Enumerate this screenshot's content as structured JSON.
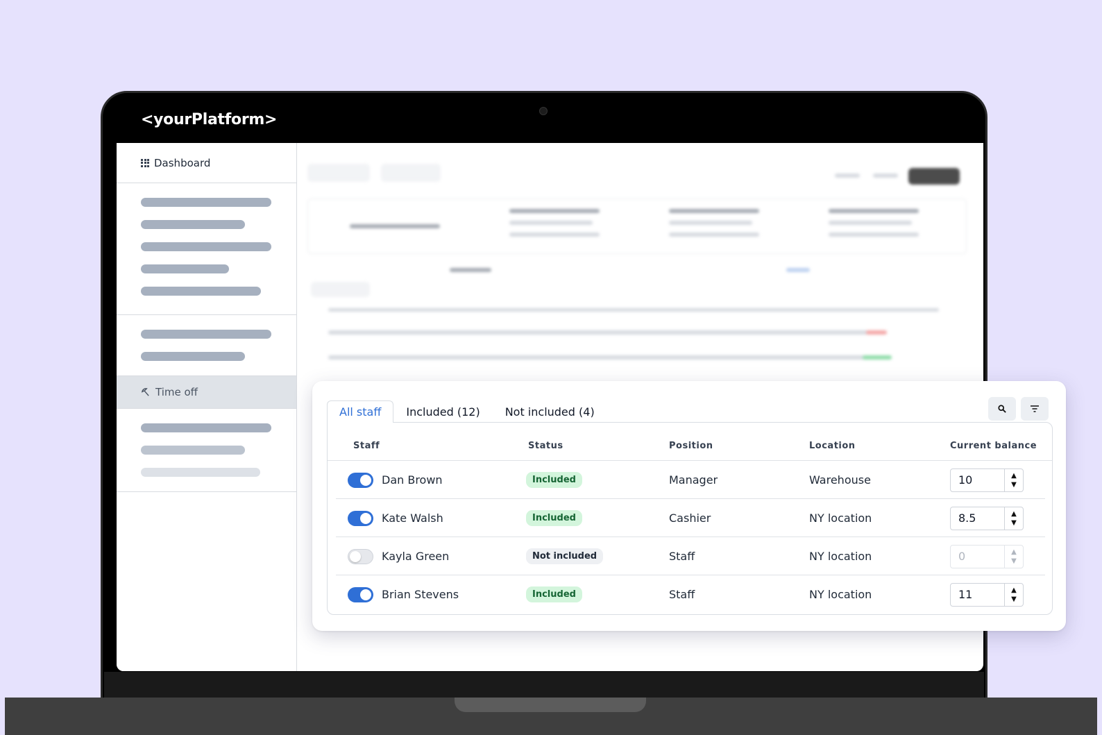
{
  "brand": "<yourPlatform>",
  "sidebar": {
    "dashboard_label": "Dashboard",
    "time_off_label": "Time off"
  },
  "tabs": [
    {
      "label": "All staff"
    },
    {
      "label": "Included (12)"
    },
    {
      "label": "Not included (4)"
    }
  ],
  "table": {
    "columns": [
      "Staff",
      "Status",
      "Position",
      "Location",
      "Current balance"
    ],
    "rows": [
      {
        "name": "Dan Brown",
        "enabled": true,
        "status": "Included",
        "position": "Manager",
        "location": "Warehouse",
        "balance": "10"
      },
      {
        "name": "Kate Walsh",
        "enabled": true,
        "status": "Included",
        "position": "Cashier",
        "location": "NY location",
        "balance": "8.5"
      },
      {
        "name": "Kayla Green",
        "enabled": false,
        "status": "Not included",
        "position": "Staff",
        "location": "NY location",
        "balance": "0"
      },
      {
        "name": "Brian Stevens",
        "enabled": true,
        "status": "Included",
        "position": "Staff",
        "location": "NY location",
        "balance": "11"
      }
    ]
  },
  "icons": {
    "search": "search-icon",
    "filter": "filter-icon",
    "stepper_up": "▲",
    "stepper_down": "▼"
  },
  "colors": {
    "accent": "#2f6fd6",
    "included_bg": "#d3f5dc",
    "included_text": "#166534",
    "background": "#e6e2fd"
  }
}
